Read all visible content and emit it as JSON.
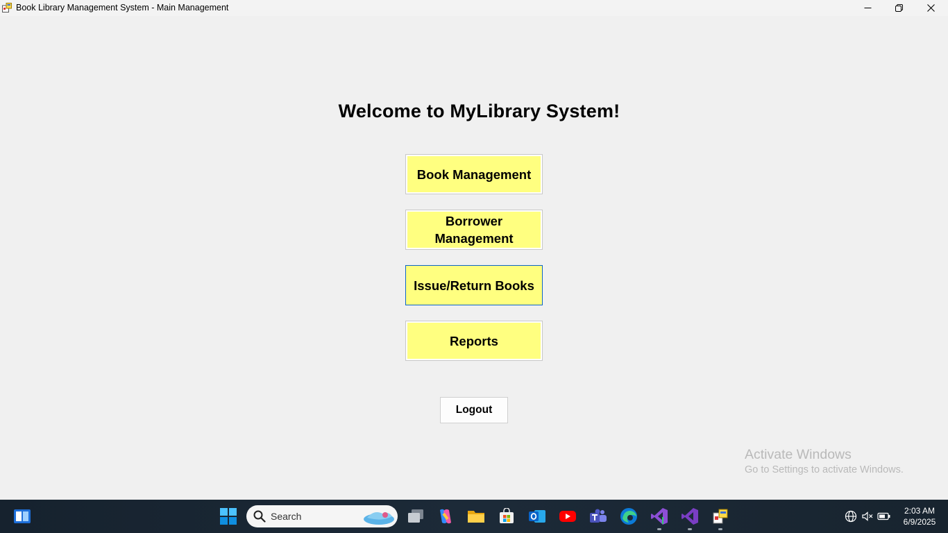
{
  "window": {
    "title": "Book Library Management System - Main Management"
  },
  "main": {
    "welcome": "Welcome to MyLibrary System!",
    "buttons": [
      {
        "label": "Book Management"
      },
      {
        "label": "Borrower Management"
      },
      {
        "label": "Issue/Return Books"
      },
      {
        "label": "Reports"
      }
    ],
    "logout_label": "Logout"
  },
  "watermark": {
    "line1": "Activate Windows",
    "line2": "Go to Settings to activate Windows."
  },
  "taskbar": {
    "search_placeholder": "Search",
    "time": "2:03 AM",
    "date": "6/9/2025",
    "apps": [
      "start-icon",
      "task-view-icon",
      "copilot-icon",
      "file-explorer-icon",
      "microsoft-store-icon",
      "outlook-icon",
      "youtube-icon",
      "teams-icon",
      "edge-icon",
      "visual-studio-icon",
      "visual-studio-icon",
      "library-app-icon"
    ]
  },
  "colors": {
    "menu_button_bg": "#ffff80",
    "focus_border": "#0a64c8",
    "window_bg": "#f0f0f0",
    "taskbar_bg": "#1c2a38"
  }
}
